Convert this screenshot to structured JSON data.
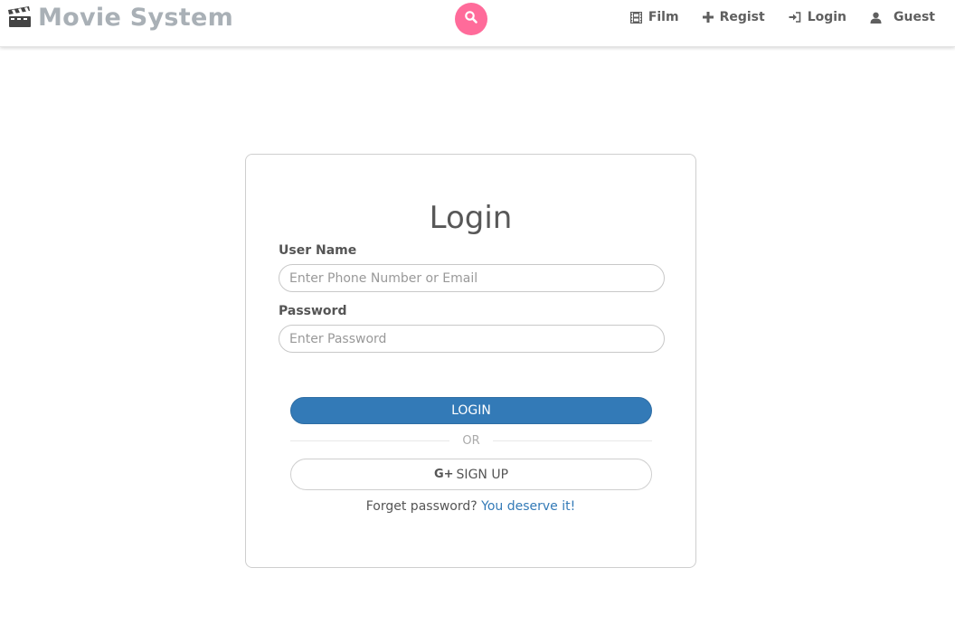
{
  "navbar": {
    "brand": {
      "icon": "clapperboard-icon",
      "title": "Movie System"
    },
    "search": {
      "icon": "search-icon",
      "color": "#ff6b9a"
    },
    "items": [
      {
        "icon": "film-icon",
        "label": "Film"
      },
      {
        "icon": "plus-icon",
        "label": "Regist"
      },
      {
        "icon": "login-icon",
        "label": "Login"
      },
      {
        "icon": "user-icon",
        "label": "Guest"
      }
    ]
  },
  "login_form": {
    "title": "Login",
    "username": {
      "label": "User Name",
      "value": "",
      "placeholder": "Enter Phone Number or Email"
    },
    "password": {
      "label": "Password",
      "value": "",
      "placeholder": "Enter Password"
    },
    "login_button": "LOGIN",
    "divider": "OR",
    "signup_button": {
      "icon": "google-plus-icon",
      "icon_text": "G+",
      "label": "SIGN UP"
    },
    "forgot": {
      "text": "Forget password?",
      "link": "You deserve it!"
    }
  },
  "colors": {
    "primary": "#337ab7",
    "accent": "#ff6b9a",
    "brand": "#a9b0b6"
  }
}
